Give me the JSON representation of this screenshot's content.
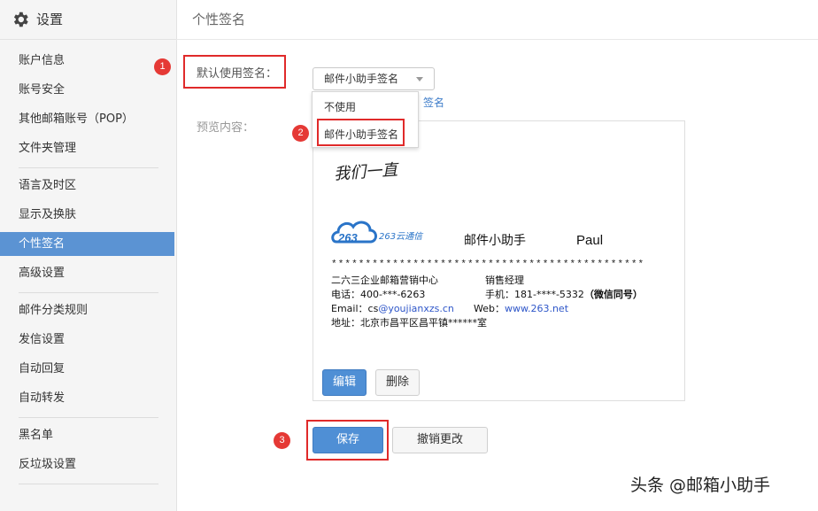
{
  "sidebar": {
    "title": "设置",
    "groups": [
      [
        "账户信息",
        "账号安全",
        "其他邮箱账号（POP）",
        "文件夹管理"
      ],
      [
        "语言及时区",
        "显示及换肤",
        "个性签名",
        "高级设置"
      ],
      [
        "邮件分类规则",
        "发信设置",
        "自动回复",
        "自动转发"
      ],
      [
        "黑名单",
        "反垃圾设置"
      ]
    ],
    "active_item": "个性签名"
  },
  "main": {
    "title": "个性签名",
    "default_signature_label": "默认使用签名：",
    "preview_label": "预览内容：",
    "select_value": "邮件小助手签名",
    "dropdown_options": [
      "不使用",
      "邮件小助手签名"
    ],
    "partial_link": "签名"
  },
  "annotations": {
    "badge1": "1",
    "badge2": "2",
    "badge3": "3",
    "highlight_color": "#e02a2a"
  },
  "signature": {
    "handwriting": "我们一直",
    "logo_text": "263云通信",
    "assistant": "邮件小助手",
    "name": "Paul",
    "stars": "**********************************************",
    "company": "二六三企业邮箱营销中心",
    "position": "销售经理",
    "phone": "电话：400-***-6263",
    "mobile": "手机：181-****-5332",
    "mobile_note": "（微信同号）",
    "email_label": "Email：",
    "email_prefix": "cs",
    "email_domain": "@youjianxzs.cn",
    "web_label": "Web：",
    "web_value": "www.263.net",
    "address": "地址：北京市昌平区昌平镇******室"
  },
  "buttons": {
    "edit": "编辑",
    "delete": "删除",
    "save": "保存",
    "cancel": "撤销更改"
  },
  "watermark": "头条 @邮箱小助手",
  "colors": {
    "accent": "#4f8fd5",
    "active_nav": "#5b93d3",
    "link": "#3d7cc9"
  }
}
